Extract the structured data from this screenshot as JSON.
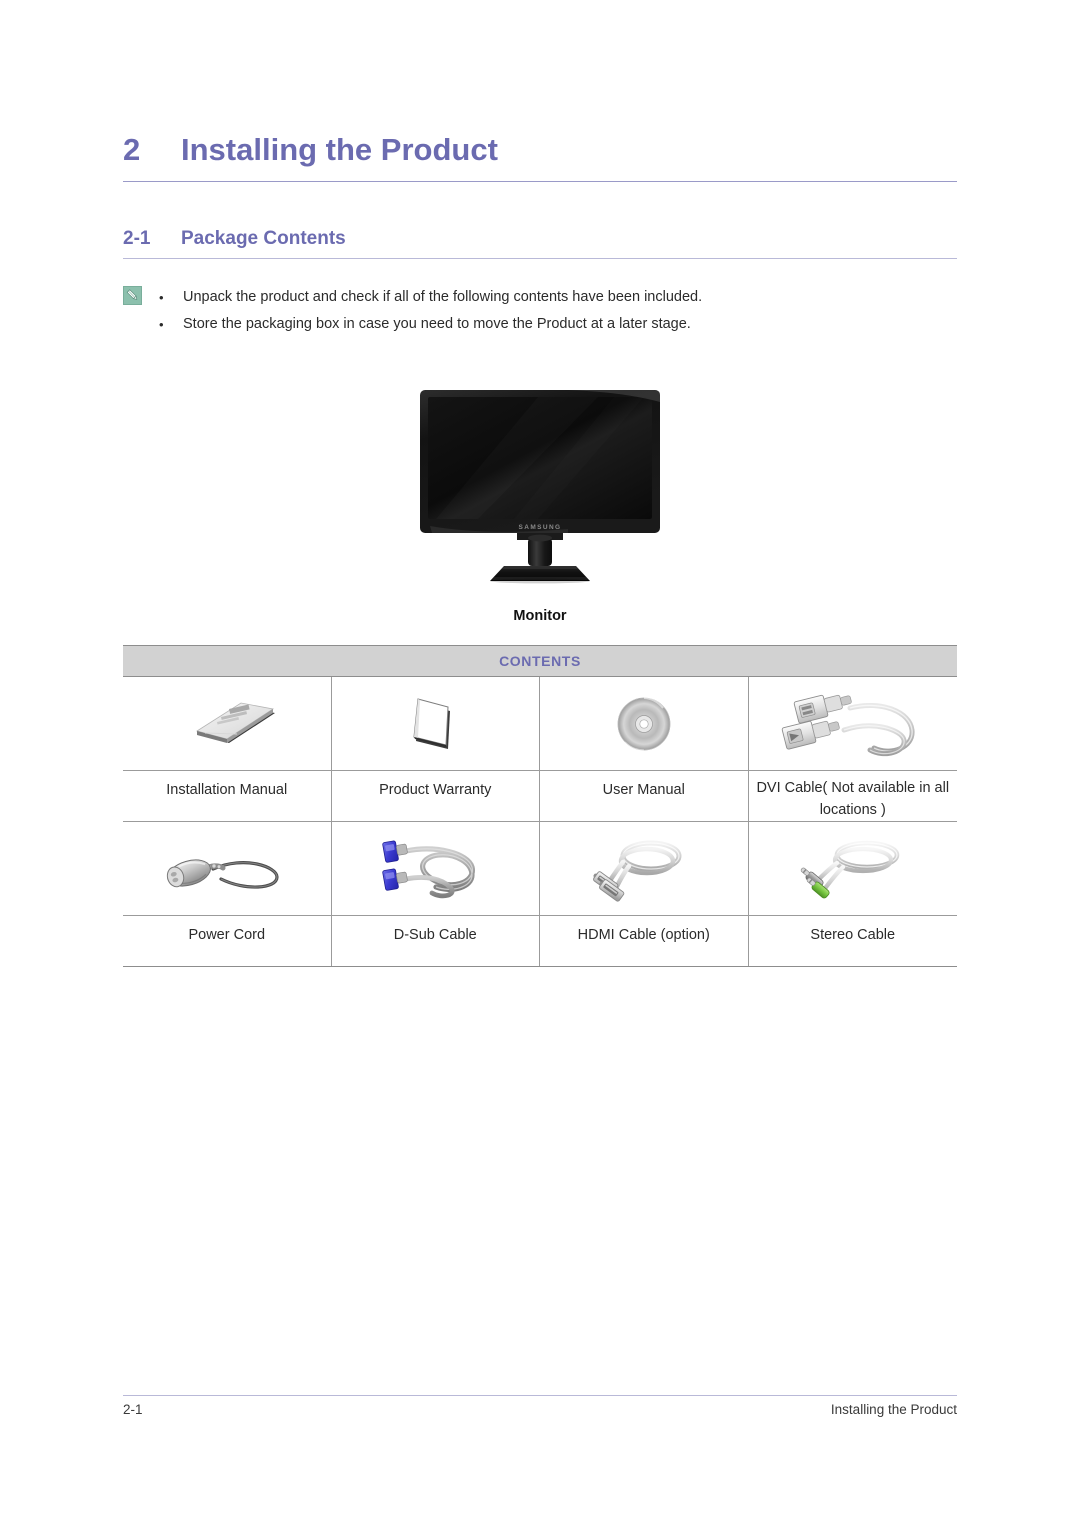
{
  "chapter": {
    "number": "2",
    "title": "Installing the Product"
  },
  "section": {
    "number": "2-1",
    "title": "Package Contents"
  },
  "note": {
    "icon": "note-pencil-icon",
    "bullet_glyph": "•",
    "lines": [
      "Unpack the product and check if all of the following contents have been included.",
      "Store the packaging box in case you need to move the Product at a later stage."
    ]
  },
  "hero": {
    "image_name": "samsung-monitor-illustration",
    "brand_text": "SAMSUNG",
    "caption": "Monitor"
  },
  "contents_table": {
    "banner_label": "CONTENTS",
    "banner_color": "#6b6bb0",
    "banner_background": "#d2d2d2",
    "rows": [
      {
        "items": [
          {
            "icon": "installation-manual-icon",
            "label": "Installation Manual"
          },
          {
            "icon": "product-warranty-icon",
            "label": "Product Warranty"
          },
          {
            "icon": "user-manual-cd-icon",
            "label": "User Manual"
          },
          {
            "icon": "dvi-cable-icon",
            "label": "DVI Cable( Not available in all locations )"
          }
        ]
      },
      {
        "items": [
          {
            "icon": "power-cord-icon",
            "label": "Power Cord"
          },
          {
            "icon": "d-sub-cable-icon",
            "label": "D-Sub Cable"
          },
          {
            "icon": "hdmi-cable-icon",
            "label": "HDMI Cable (option)"
          },
          {
            "icon": "stereo-cable-icon",
            "label": "Stereo Cable"
          }
        ]
      }
    ]
  },
  "footer": {
    "page_number": "2-1",
    "section_name": "Installing the Product"
  },
  "colors": {
    "heading": "#6b6bb0",
    "rule": "#9a9ac8",
    "table_border": "#9b9b9b",
    "note_icon": "#8cc0ad",
    "dsub_connector": "#3a3ad0",
    "stereo_jack_green": "#7ac943"
  }
}
